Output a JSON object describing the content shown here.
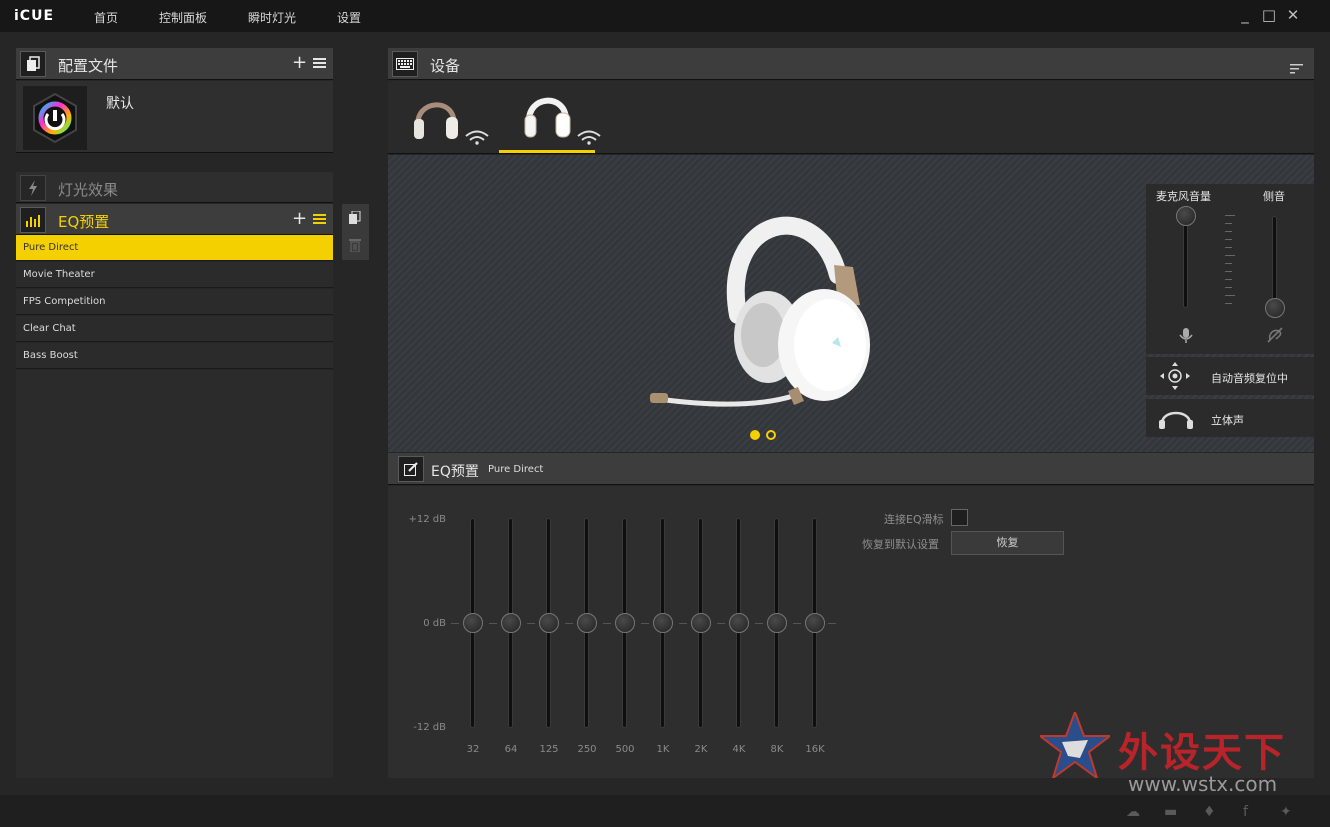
{
  "app": {
    "brand": "iCUE",
    "nav": [
      "首页",
      "控制面板",
      "瞬时灯光",
      "设置"
    ],
    "window": {
      "minimize": "_",
      "maximize": "□",
      "close": "✕"
    }
  },
  "profiles": {
    "title": "配置文件",
    "add": "+",
    "items": [
      {
        "name": "默认"
      }
    ]
  },
  "lighting": {
    "title": "灯光效果"
  },
  "eq_presets": {
    "title": "EQ预置",
    "add": "+",
    "items": [
      "Pure Direct",
      "Movie Theater",
      "FPS Competition",
      "Clear Chat",
      "Bass Boost"
    ],
    "selected": "Pure Direct"
  },
  "side_tools": {
    "copy": "copy-icon",
    "delete": "trash-icon"
  },
  "devices": {
    "title": "设备",
    "page_dots": 2,
    "active_dot": 0,
    "selected_device": 1
  },
  "audio_panel": {
    "mic_volume_label": "麦克风音量",
    "sidetone_label": "侧音",
    "mic_level": 1.0,
    "sidetone_level": 0.0,
    "auto_label": "自动音频复位中",
    "stereo_label": "立体声"
  },
  "eq_panel": {
    "title": "EQ预置",
    "preset_name": "Pure Direct",
    "db_labels": {
      "top": "+12 dB",
      "mid": "0 dB",
      "bottom": "-12 dB"
    },
    "bands": [
      "32",
      "64",
      "125",
      "250",
      "500",
      "1K",
      "2K",
      "4K",
      "8K",
      "16K"
    ],
    "band_values_db": [
      0,
      0,
      0,
      0,
      0,
      0,
      0,
      0,
      0,
      0
    ],
    "link_label": "连接EQ滑标",
    "reset_label": "恢复到默认设置",
    "reset_button": "恢复"
  },
  "watermark": {
    "text": "外设天下",
    "url": "www.wstx.com"
  },
  "colors": {
    "accent": "#f5d000",
    "background": "#262626",
    "panel": "#3d3d3d"
  }
}
